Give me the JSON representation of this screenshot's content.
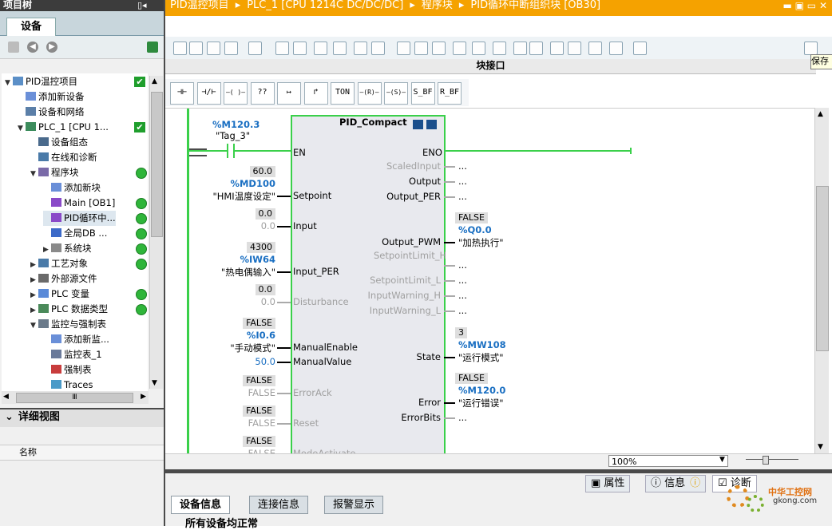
{
  "left_panel": {
    "title": "项目树",
    "tab": "设备",
    "tree": [
      {
        "label": "PID温控项目",
        "level": 0,
        "arrow": "▼",
        "status": "check",
        "icon_color": "#5b8fc7"
      },
      {
        "label": "添加新设备",
        "level": 1,
        "arrow": "",
        "status": "",
        "icon_color": "#6a8fd8"
      },
      {
        "label": "设备和网络",
        "level": 1,
        "arrow": "",
        "status": "",
        "icon_color": "#5b7fa8"
      },
      {
        "label": "PLC_1 [CPU 1...",
        "level": 1,
        "arrow": "▼",
        "status": "check",
        "icon_color": "#3c8c5c"
      },
      {
        "label": "设备组态",
        "level": 2,
        "arrow": "",
        "status": "",
        "icon_color": "#4a6a8c"
      },
      {
        "label": "在线和诊断",
        "level": 2,
        "arrow": "",
        "status": "",
        "icon_color": "#4a7aa8"
      },
      {
        "label": "程序块",
        "level": 2,
        "arrow": "▼",
        "status": "dot",
        "icon_color": "#7a6aa8"
      },
      {
        "label": "添加新块",
        "level": 3,
        "arrow": "",
        "status": "",
        "icon_color": "#6a8fd8"
      },
      {
        "label": "Main [OB1]",
        "level": 3,
        "arrow": "",
        "status": "dot",
        "icon_color": "#8a4ac8"
      },
      {
        "label": "PID循环中...",
        "level": 3,
        "arrow": "",
        "status": "dot",
        "icon_color": "#8a4ac8",
        "selected": true
      },
      {
        "label": "全局DB ...",
        "level": 3,
        "arrow": "",
        "status": "dot",
        "icon_color": "#3c6ac8"
      },
      {
        "label": "系统块",
        "level": 3,
        "arrow": "▶",
        "status": "dot",
        "icon_color": "#8a8a8a"
      },
      {
        "label": "工艺对象",
        "level": 2,
        "arrow": "▶",
        "status": "dot",
        "icon_color": "#4a7aa8"
      },
      {
        "label": "外部源文件",
        "level": 2,
        "arrow": "▶",
        "status": "",
        "icon_color": "#6a6a6a"
      },
      {
        "label": "PLC 变量",
        "level": 2,
        "arrow": "▶",
        "status": "dot",
        "icon_color": "#5a8ad8"
      },
      {
        "label": "PLC 数据类型",
        "level": 2,
        "arrow": "▶",
        "status": "dot",
        "icon_color": "#4a8a5a"
      },
      {
        "label": "监控与强制表",
        "level": 2,
        "arrow": "▼",
        "status": "",
        "icon_color": "#6a7a8a"
      },
      {
        "label": "添加新监...",
        "level": 3,
        "arrow": "",
        "status": "",
        "icon_color": "#6a8fd8"
      },
      {
        "label": "监控表_1",
        "level": 3,
        "arrow": "",
        "status": "",
        "icon_color": "#6a7a9a"
      },
      {
        "label": "强制表",
        "level": 3,
        "arrow": "",
        "status": "",
        "icon_color": "#c83c3c"
      },
      {
        "label": "Traces",
        "level": 3,
        "arrow": "",
        "status": "",
        "icon_color": "#4a9ac8"
      }
    ],
    "detail_title": "详细视图",
    "detail_column": "名称",
    "hscroll_thumb": "Ⅲ"
  },
  "titlebar": {
    "crumbs": [
      "PID温控项目",
      "PLC_1 [CPU 1214C DC/DC/DC]",
      "程序块",
      "PID循环中断组织块 [OB30]"
    ],
    "sep": "▸"
  },
  "editor": {
    "block_interface": "块接口",
    "save_tip": "保存",
    "ladder_buttons": [
      "⊣⊢",
      "⊣/⊢",
      "–( )–",
      "??",
      "↦",
      "↱",
      "TON",
      "–(R)–",
      "–(S)–",
      "S_BF",
      "R_BF"
    ],
    "zoom": "100%"
  },
  "fbd": {
    "block_name": "PID_Compact",
    "en_addr": "%M120.3",
    "en_tag": "\"Tag_3\"",
    "pin_en": "EN",
    "pin_eno": "ENO",
    "inputs": [
      {
        "pin": "Setpoint",
        "val": "60.0",
        "addr": "%MD100",
        "tag": "\"HMI温度设定\"",
        "active": true
      },
      {
        "pin": "Input",
        "val": "0.0",
        "addr": "",
        "tag": "0.0",
        "active": true
      },
      {
        "pin": "Input_PER",
        "val": "4300",
        "addr": "%IW64",
        "tag": "\"热电偶输入\"",
        "active": true
      },
      {
        "pin": "Disturbance",
        "val": "0.0",
        "addr": "",
        "tag": "0.0",
        "active": false
      },
      {
        "pin": "ManualEnable",
        "val": "FALSE",
        "addr": "%I0.6",
        "tag": "\"手动模式\"",
        "active": true
      },
      {
        "pin": "ManualValue",
        "val": "",
        "addr": "",
        "tag": "50.0",
        "active": true
      },
      {
        "pin": "ErrorAck",
        "val": "FALSE",
        "addr": "",
        "tag": "FALSE",
        "active": false
      },
      {
        "pin": "Reset",
        "val": "FALSE",
        "addr": "",
        "tag": "FALSE",
        "active": false
      },
      {
        "pin": "ModeActivate",
        "val": "FALSE",
        "addr": "",
        "tag": "FALSE",
        "active": false
      }
    ],
    "outputs": [
      {
        "pin": "ScaledInput",
        "active": false,
        "val": "",
        "addr": "",
        "tag": "..."
      },
      {
        "pin": "Output",
        "active": true,
        "val": "",
        "addr": "",
        "tag": "..."
      },
      {
        "pin": "Output_PER",
        "active": true,
        "val": "",
        "addr": "",
        "tag": "..."
      },
      {
        "pin": "Output_PWM",
        "active": true,
        "val": "FALSE",
        "addr": "%Q0.0",
        "tag": "\"加热执行\""
      },
      {
        "pin": "SetpointLimit_H",
        "active": false,
        "val": "",
        "addr": "",
        "tag": "..."
      },
      {
        "pin": "SetpointLimit_L",
        "active": false,
        "val": "",
        "addr": "",
        "tag": "..."
      },
      {
        "pin": "InputWarning_H",
        "active": false,
        "val": "",
        "addr": "",
        "tag": "..."
      },
      {
        "pin": "InputWarning_L",
        "active": false,
        "val": "",
        "addr": "",
        "tag": "..."
      },
      {
        "pin": "State",
        "active": true,
        "val": "3",
        "addr": "%MW108",
        "tag": "\"运行模式\""
      },
      {
        "pin": "Error",
        "active": true,
        "val": "FALSE",
        "addr": "%M120.0",
        "tag": "\"运行错误\""
      },
      {
        "pin": "ErrorBits",
        "active": true,
        "val": "",
        "addr": "",
        "tag": "..."
      }
    ]
  },
  "inspector": {
    "tabs": [
      "属性",
      "信息",
      "诊断"
    ],
    "sub_tabs": [
      "设备信息",
      "连接信息",
      "报警显示"
    ],
    "status_line": "所有设备均正常"
  },
  "watermark": {
    "line1": "中华工控网",
    "line2": "gkong.com"
  },
  "colors": {
    "accent": "#f5a200",
    "green": "#2fb53a",
    "address": "#1a6fc2",
    "powerrail": "#3ad04a"
  }
}
